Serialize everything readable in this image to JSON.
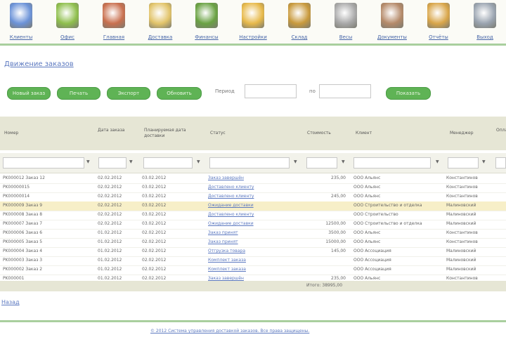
{
  "toolbar": {
    "items": [
      {
        "label": "Клиенты",
        "icon": "people-icon",
        "color": "#6c93d8"
      },
      {
        "label": "Офис",
        "icon": "manager-icon",
        "color": "#8fbf4d"
      },
      {
        "label": "Главная",
        "icon": "team-icon",
        "color": "#c9704f"
      },
      {
        "label": "Доставка",
        "icon": "truck-icon",
        "color": "#e2c46a"
      },
      {
        "label": "Финансы",
        "icon": "money-icon",
        "color": "#6aa243"
      },
      {
        "label": "Настройки",
        "icon": "tools-icon",
        "color": "#e7b94a"
      },
      {
        "label": "Склад",
        "icon": "box-icon",
        "color": "#c99a3d"
      },
      {
        "label": "Весы",
        "icon": "scale-icon",
        "color": "#a9a9a9"
      },
      {
        "label": "Документы",
        "icon": "archive-icon",
        "color": "#b58a6a"
      },
      {
        "label": "Отчёты",
        "icon": "notebook-icon",
        "color": "#d9a64a"
      },
      {
        "label": "Выход",
        "icon": "exit-icon",
        "color": "#9aa4b0"
      }
    ]
  },
  "page_title": "Движение заказов",
  "actions": {
    "buttons": [
      "Новый заказ",
      "Печать",
      "Экспорт",
      "Обновить"
    ],
    "period_from_label": "Период",
    "period_to_label": "по",
    "period_from_value": "",
    "period_to_value": "",
    "apply_button": "Показать"
  },
  "table": {
    "columns": [
      "Номер",
      "Дата заказа",
      "Планируемая дата доставки",
      "Статус",
      "Стоимость",
      "Клиент",
      "Менеджер",
      "Оплата"
    ],
    "rows": [
      {
        "num": "PK000012 Заказ 12",
        "date": "02.02.2012",
        "plan": "03.02.2012",
        "status": "Заказ завершён",
        "cost": "235,00",
        "client": "ООО Альянс",
        "manager": "Константинов",
        "hl": false
      },
      {
        "num": "PK00000015",
        "date": "02.02.2012",
        "plan": "03.02.2012",
        "status": "Доставлено клиенту",
        "cost": "",
        "client": "ООО Альянс",
        "manager": "Константинов",
        "hl": false
      },
      {
        "num": "PK00000014",
        "date": "02.02.2012",
        "plan": "03.02.2012",
        "status": "Доставлено клиенту",
        "cost": "245,00",
        "client": "ООО Альянс",
        "manager": "Константинов",
        "hl": false
      },
      {
        "num": "PK000009 Заказ 9",
        "date": "02.02.2012",
        "plan": "03.02.2012",
        "status": "Ожидание доставки",
        "cost": "",
        "client": "ООО Строительство и отделка",
        "manager": "Малиновский",
        "hl": true
      },
      {
        "num": "PK000008 Заказ 8",
        "date": "02.02.2012",
        "plan": "03.02.2012",
        "status": "Доставлено клиенту",
        "cost": "",
        "client": "ООО Строительство",
        "manager": "Малиновский",
        "hl": false
      },
      {
        "num": "PK000007 Заказ 7",
        "date": "02.02.2012",
        "plan": "03.02.2012",
        "status": "Ожидание доставки",
        "cost": "12500,00",
        "client": "ООО Строительство и отделка",
        "manager": "Малиновский",
        "hl": false
      },
      {
        "num": "PK000006 Заказ 6",
        "date": "01.02.2012",
        "plan": "02.02.2012",
        "status": "Заказ принят",
        "cost": "3500,00",
        "client": "ООО Альянс",
        "manager": "Константинов",
        "hl": false
      },
      {
        "num": "PK000005 Заказ 5",
        "date": "01.02.2012",
        "plan": "02.02.2012",
        "status": "Заказ принят",
        "cost": "15000,00",
        "client": "ООО Альянс",
        "manager": "Константинов",
        "hl": false
      },
      {
        "num": "PK000004 Заказ 4",
        "date": "01.02.2012",
        "plan": "02.02.2012",
        "status": "Отгрузка товара",
        "cost": "145,00",
        "client": "ООО Ассоциация",
        "manager": "Малиновский",
        "hl": false
      },
      {
        "num": "PK000003 Заказ 3",
        "date": "01.02.2012",
        "plan": "02.02.2012",
        "status": "Комплект заказа",
        "cost": "",
        "client": "ООО Ассоциация",
        "manager": "Малиновский",
        "hl": false
      },
      {
        "num": "PK000002 Заказ 2",
        "date": "01.02.2012",
        "plan": "02.02.2012",
        "status": "Комплект заказа",
        "cost": "",
        "client": "ООО Ассоциация",
        "manager": "Малиновский",
        "hl": false
      },
      {
        "num": "PK000001",
        "date": "01.02.2012",
        "plan": "02.02.2012",
        "status": "Заказ завершён",
        "cost": "235,00",
        "client": "ООО Альянс",
        "manager": "Константинов",
        "hl": false
      }
    ],
    "total": "Итого: 38995,00"
  },
  "back_link": "Назад",
  "footer_link": "© 2012 Система управления доставкой заказов. Все права защищены."
}
